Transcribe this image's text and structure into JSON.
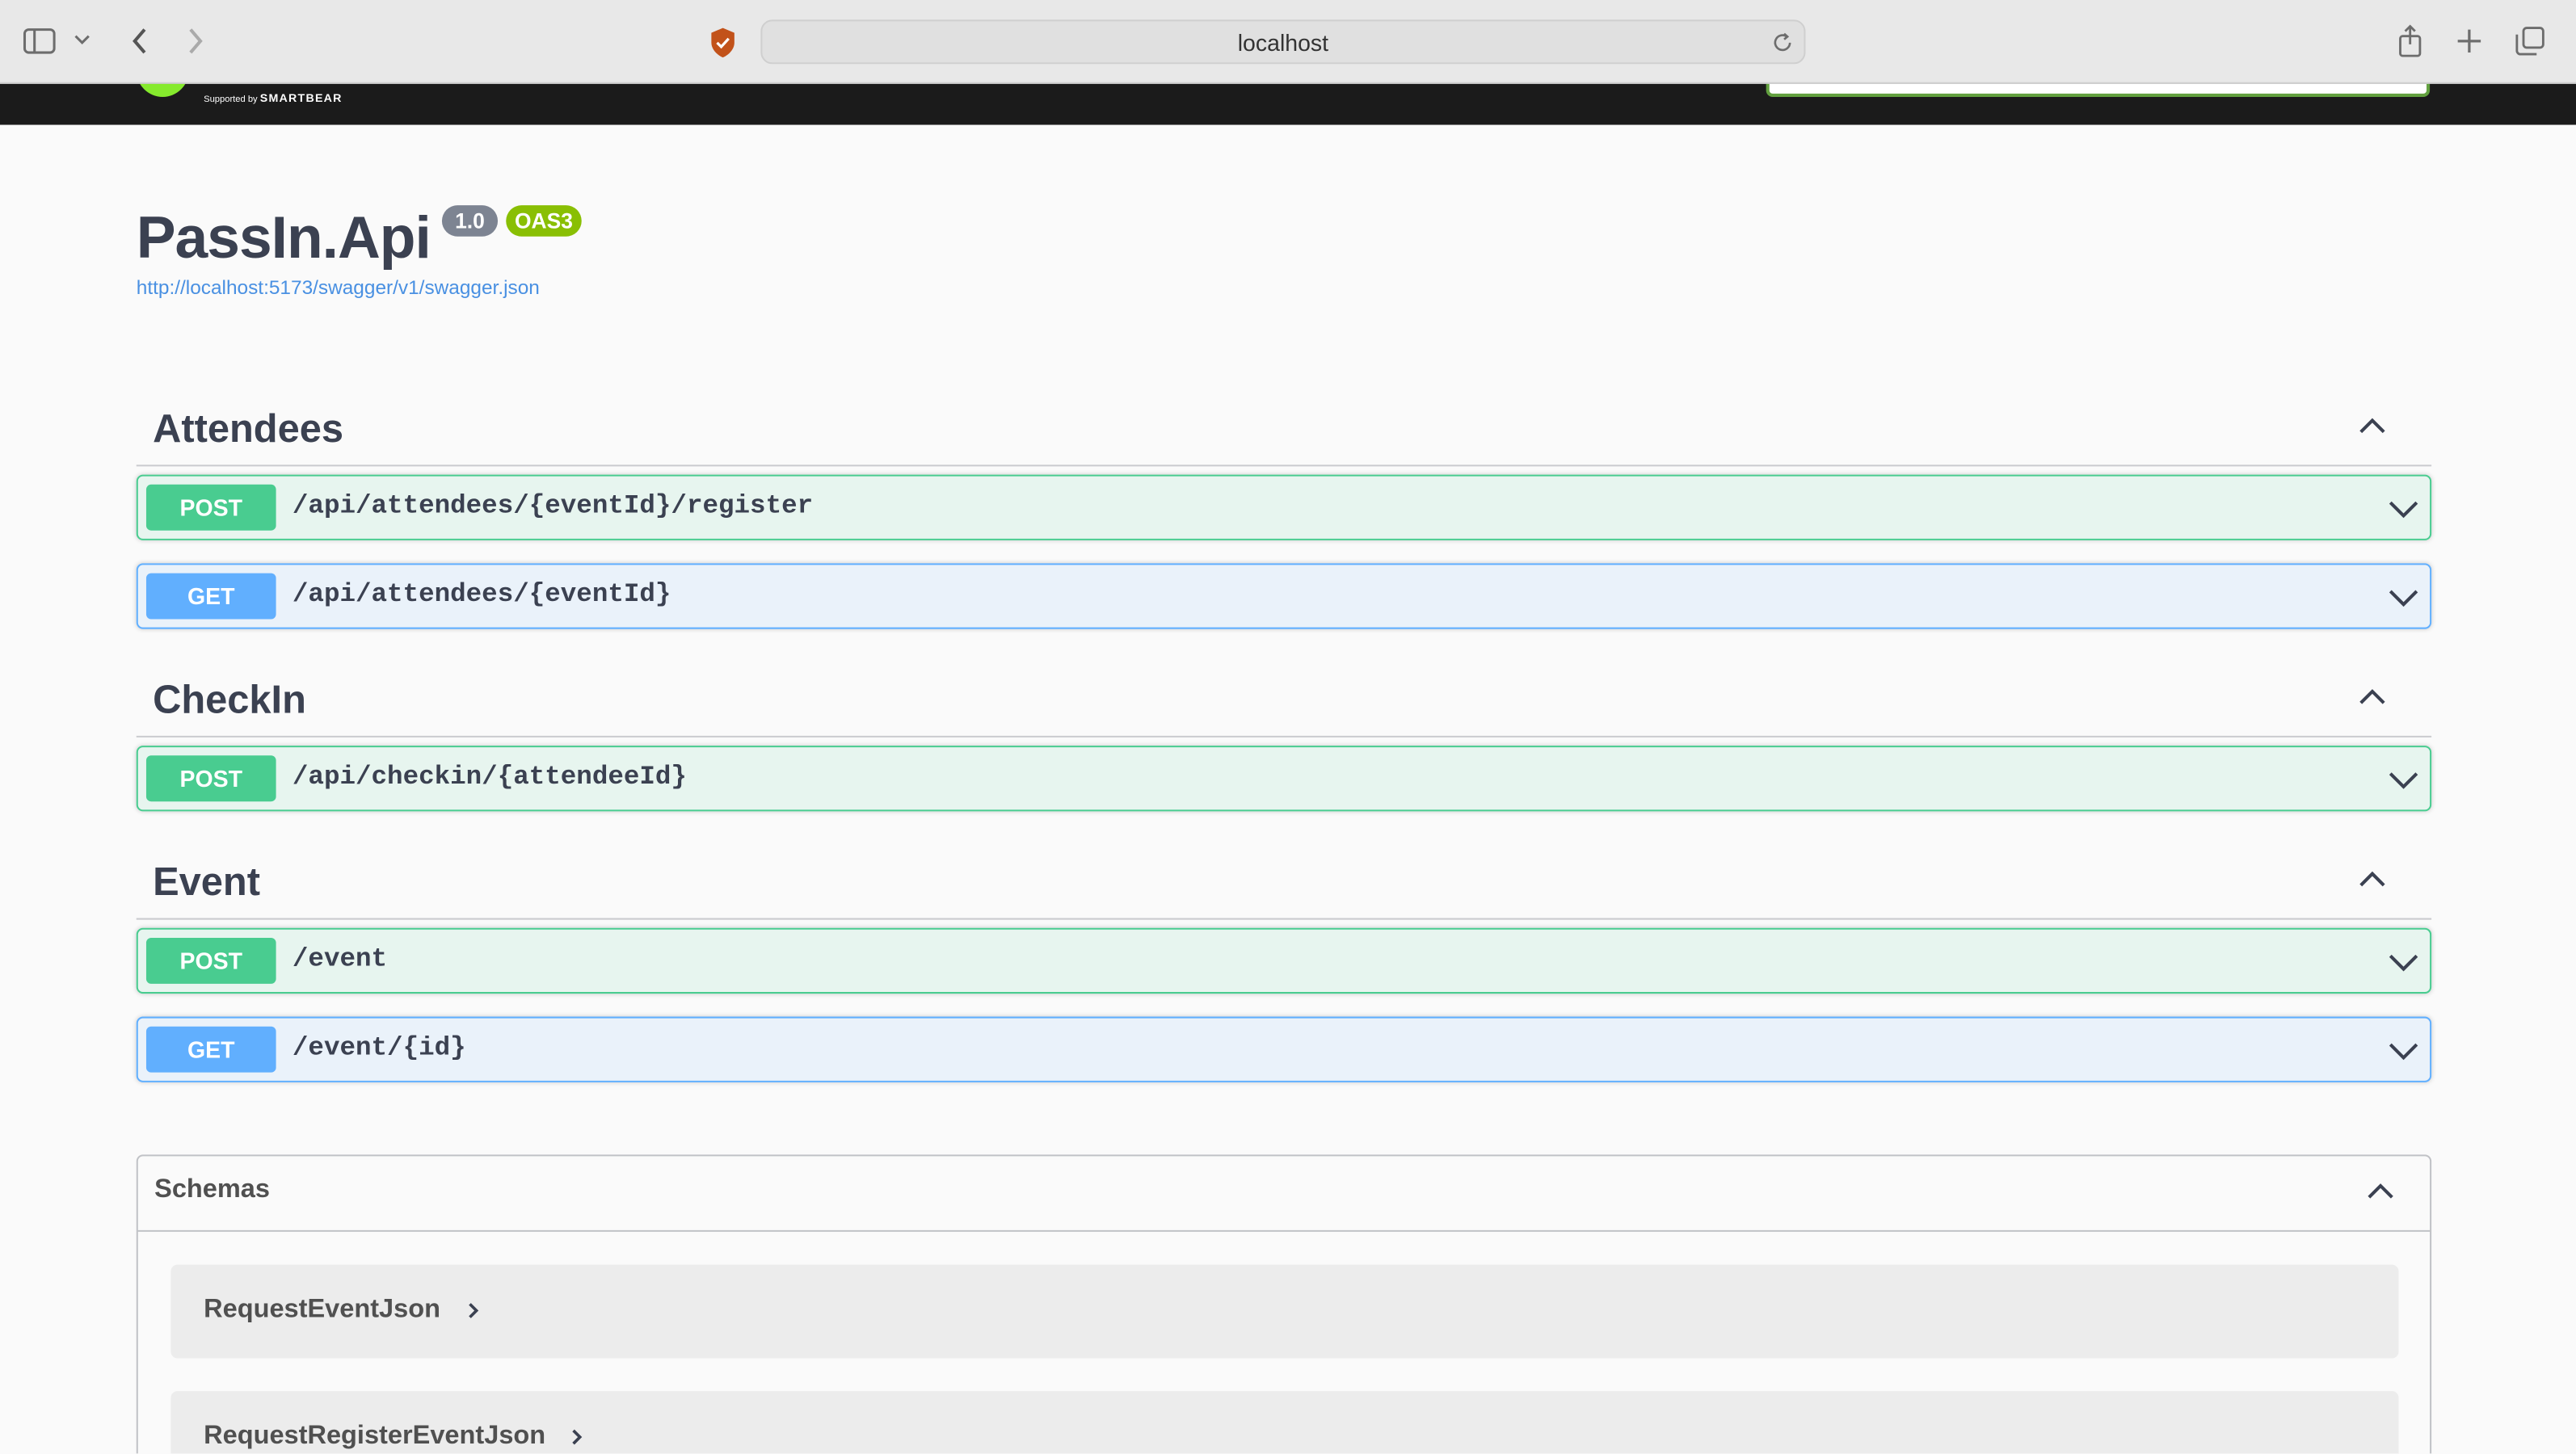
{
  "browser": {
    "url": "localhost",
    "icons": [
      "sidebar-icon",
      "chevron-down-icon",
      "back-icon",
      "forward-icon",
      "shield-icon",
      "reload-icon",
      "share-icon",
      "plus-icon",
      "tabs-icon"
    ]
  },
  "topbar": {
    "supported_by": "Supported by",
    "brand": "SMARTBEAR",
    "logo_color": "#85ea2d"
  },
  "info": {
    "title": "PassIn.Api",
    "version": "1.0",
    "oas": "OAS3",
    "url": "http://localhost:5173/swagger/v1/swagger.json"
  },
  "tags": [
    {
      "name": "Attendees",
      "operations": [
        {
          "method": "POST",
          "path": "/api/attendees/{eventId}/register"
        },
        {
          "method": "GET",
          "path": "/api/attendees/{eventId}"
        }
      ]
    },
    {
      "name": "CheckIn",
      "operations": [
        {
          "method": "POST",
          "path": "/api/checkin/{attendeeId}"
        }
      ]
    },
    {
      "name": "Event",
      "operations": [
        {
          "method": "POST",
          "path": "/event"
        },
        {
          "method": "GET",
          "path": "/event/{id}"
        }
      ]
    }
  ],
  "schemas": {
    "title": "Schemas",
    "models": [
      "RequestEventJson",
      "RequestRegisterEventJson"
    ]
  },
  "colors": {
    "post": "#49cc90",
    "get": "#61affe",
    "text": "#3b4151",
    "link": "#4990e2",
    "oas_badge": "#89bf04",
    "version_badge": "#7d8492"
  }
}
